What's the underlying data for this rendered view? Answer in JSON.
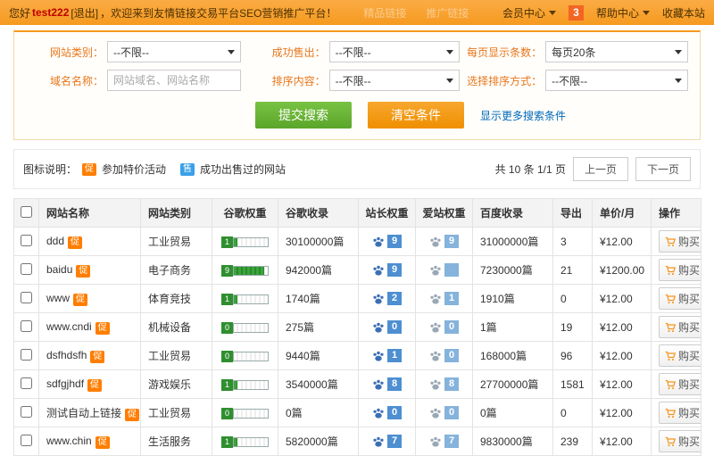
{
  "topbar": {
    "greeting_prefix": "您好",
    "username": "test222",
    "logout": "[退出]",
    "welcome": "，欢迎来到友情链接交易平台SEO营销推广平台！",
    "faded_nav": [
      "精品链接",
      "推广链接"
    ],
    "member_center": "会员中心",
    "notification_count": "3",
    "help_center": "帮助中心",
    "favorite": "收藏本站"
  },
  "search": {
    "fields": [
      {
        "label": "网站类别：",
        "value": "--不限--"
      },
      {
        "label": "成功售出：",
        "value": "--不限--"
      },
      {
        "label": "每页显示条数：",
        "value": "每页20条"
      },
      {
        "label": "域名名称：",
        "placeholder": "网站域名、网站名称"
      },
      {
        "label": "排序内容：",
        "value": "--不限--"
      },
      {
        "label": "选择排序方式：",
        "value": "--不限--"
      }
    ],
    "submit_label": "提交搜索",
    "clear_label": "清空条件",
    "more_label": "显示更多搜索条件"
  },
  "legend": {
    "label": "图标说明：",
    "promo_badge": "促",
    "promo_text": "参加特价活动",
    "sold_badge": "售",
    "sold_text": "成功出售过的网站",
    "total_text": "共 10 条 1/1 页",
    "prev_label": "上一页",
    "next_label": "下一页"
  },
  "table": {
    "headers": [
      "网站名称",
      "网站类别",
      "谷歌权重",
      "谷歌收录",
      "站长权重",
      "爱站权重",
      "百度收录",
      "导出",
      "单价/月",
      "操作"
    ],
    "buy_label": "购买",
    "rows": [
      {
        "name": "ddd",
        "promo": true,
        "category": "工业贸易",
        "pr": 1,
        "google_index": "30100000篇",
        "zz": "9",
        "az": "9",
        "baidu_index": "31000000篇",
        "out": "3",
        "price": "¥12.00"
      },
      {
        "name": "baidu",
        "promo": true,
        "category": "电子商务",
        "pr": 9,
        "google_index": "942000篇",
        "zz": "9",
        "az": "",
        "baidu_index": "7230000篇",
        "out": "21",
        "price": "¥1200.00"
      },
      {
        "name": "www",
        "promo": true,
        "category": "体育竞技",
        "pr": 1,
        "google_index": "1740篇",
        "zz": "2",
        "az": "1",
        "baidu_index": "1910篇",
        "out": "0",
        "price": "¥12.00"
      },
      {
        "name": "www.cndi",
        "promo": true,
        "category": "机械设备",
        "pr": 0,
        "google_index": "275篇",
        "zz": "0",
        "az": "0",
        "baidu_index": "1篇",
        "out": "19",
        "price": "¥12.00"
      },
      {
        "name": "dsfhdsfh",
        "promo": true,
        "category": "工业贸易",
        "pr": 0,
        "google_index": "9440篇",
        "zz": "1",
        "az": "0",
        "baidu_index": "168000篇",
        "out": "96",
        "price": "¥12.00"
      },
      {
        "name": "sdfgjhdf",
        "promo": true,
        "category": "游戏娱乐",
        "pr": 1,
        "google_index": "3540000篇",
        "zz": "8",
        "az": "8",
        "baidu_index": "27700000篇",
        "out": "1581",
        "price": "¥12.00"
      },
      {
        "name": "测试自动上链接",
        "promo": true,
        "category": "工业贸易",
        "pr": 0,
        "google_index": "0篇",
        "zz": "0",
        "az": "0",
        "baidu_index": "0篇",
        "out": "0",
        "price": "¥12.00"
      },
      {
        "name": "www.chin",
        "promo": true,
        "category": "生活服务",
        "pr": 1,
        "google_index": "5820000篇",
        "zz": "7",
        "az": "7",
        "baidu_index": "9830000篇",
        "out": "239",
        "price": "¥12.00"
      }
    ]
  }
}
